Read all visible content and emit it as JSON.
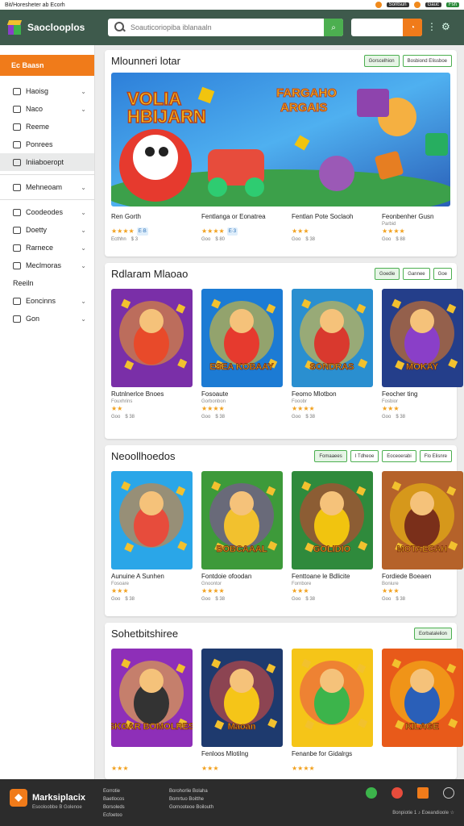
{
  "status_bar": {
    "left_text": "Bit/Horesheter ab Ecorh",
    "badges": [
      "Sontsun",
      "Gauc",
      "Fsh"
    ]
  },
  "header": {
    "brand": "Saoclooplos",
    "search_placeholder": "Soauticoriopiba iblanaaln",
    "search_button_icon": "search-icon"
  },
  "sidebar": {
    "active": "Ec Baasn",
    "items": [
      {
        "label": "Haoisg",
        "icon": "store-icon",
        "chevron": true
      },
      {
        "label": "Naco",
        "icon": "tag-icon",
        "chevron": true
      },
      {
        "label": "Reeme",
        "icon": "grid-icon",
        "chevron": false
      },
      {
        "label": "Ponrees",
        "icon": "doc-icon",
        "chevron": false
      },
      {
        "label": "Iniiaboeropt",
        "icon": "box-icon",
        "chevron": false,
        "highlight": true
      },
      {
        "label": "Mehneoam",
        "icon": "home-icon",
        "chevron": true
      },
      {
        "label": "Coodeodes",
        "icon": "folder-icon",
        "chevron": true
      },
      {
        "label": "Doetty",
        "icon": "card-icon",
        "chevron": true
      },
      {
        "label": "Rarnece",
        "icon": "clock-icon",
        "chevron": true
      },
      {
        "label": "Meclmoras",
        "icon": "circle-icon",
        "chevron": true
      },
      {
        "label": "Reeiln",
        "icon": "none",
        "chevron": false
      },
      {
        "label": "Eoncinns",
        "icon": "shield-icon",
        "chevron": true
      },
      {
        "label": "Gon",
        "icon": "globe-icon",
        "chevron": true
      }
    ]
  },
  "sections": [
    {
      "title": "Mlounneri lotar",
      "buttons": [
        "Gorscelhion",
        "Bosbiond Elissboe"
      ],
      "banner_text": [
        "VOLIA",
        "HBIJARN",
        "FARGAHO",
        "ARGAIS"
      ],
      "items": [
        {
          "title": "Ren Gorth",
          "sub": "",
          "stars": "★★★★",
          "price": "E·B",
          "meta": [
            "Ecthhn",
            "$ 3"
          ]
        },
        {
          "title": "Fentlanga or Eonatrea",
          "sub": "",
          "stars": "★★★★",
          "price": "E·3",
          "meta": [
            "Goo",
            "$ 80"
          ]
        },
        {
          "title": "Fentlan Pote Soclaoh",
          "sub": "",
          "stars": "★★★",
          "price": "",
          "meta": [
            "Goo",
            "$ 38"
          ]
        },
        {
          "title": "Feonbenher Gusn",
          "sub": "Parbid",
          "stars": "★★★★",
          "price": "",
          "meta": [
            "Goo",
            "$ 88"
          ]
        }
      ]
    },
    {
      "title": "Rdlaram Mlaoao",
      "buttons": [
        "Goedie",
        "Gannee",
        "Goe"
      ],
      "items": [
        {
          "title": "Rutnlnerlce Bnoes",
          "sub": "Fouxhrins",
          "stars": "★★",
          "meta": [
            "Goo",
            "$ 38"
          ]
        },
        {
          "title": "Fosoaute",
          "sub": "Gorbonbon",
          "stars": "★★★★",
          "meta": [
            "Goo",
            "$ 38"
          ]
        },
        {
          "title": "Feomo Mlotbon",
          "sub": "Fooobr",
          "stars": "★★★★",
          "meta": [
            "Goo",
            "$ 38"
          ]
        },
        {
          "title": "Feocher ting",
          "sub": "Fosbior",
          "stars": "★★★",
          "meta": [
            "Goo",
            "$ 38"
          ]
        }
      ],
      "thumb_text": [
        "",
        "ESEA KOBAAY",
        "SONDRAS",
        "MOKAY"
      ]
    },
    {
      "title": "Neoollhoedos",
      "buttons": [
        "Fomaaees",
        "I Tdheoe",
        "Eoceoerabi",
        "Flo Elisnre"
      ],
      "items": [
        {
          "title": "Aunuine A Sunhen",
          "sub": "Fosoare",
          "stars": "★★★",
          "meta": [
            "Goo",
            "$ 38"
          ]
        },
        {
          "title": "Fontdoie ofoodan",
          "sub": "Gnoontor",
          "stars": "★★★★",
          "meta": [
            "Goo",
            "$ 38"
          ]
        },
        {
          "title": "Fenttoane le Bdlicite",
          "sub": "Fornbore",
          "stars": "★★★",
          "meta": [
            "Goo",
            "$ 38"
          ]
        },
        {
          "title": "Fordiede Boeaen",
          "sub": "Boniure",
          "stars": "★★★",
          "meta": [
            "Goo",
            "$ 38"
          ]
        }
      ],
      "thumb_text": [
        "",
        "BOBCAAAL",
        "GOLIDIO",
        "MOTAECAH"
      ]
    },
    {
      "title": "Sohetbitshiree",
      "buttons": [
        "Eorbatalelion"
      ],
      "items": [
        {
          "title": "",
          "sub": "",
          "stars": "★★★",
          "meta": []
        },
        {
          "title": "Fenloos Mlotilng",
          "sub": "",
          "stars": "★★★",
          "meta": []
        },
        {
          "title": "Fenanbe for Gidalrgs",
          "sub": "",
          "stars": "★★★★",
          "meta": []
        },
        {
          "title": "",
          "sub": "",
          "stars": "",
          "meta": []
        }
      ],
      "thumb_text": [
        "SKGAR BOMOLRES",
        "Maoan",
        "",
        "KILAGE"
      ]
    }
  ],
  "footer": {
    "brand": "Marksiplacix",
    "tagline": "Esooloobbe B Golenoe",
    "col1": [
      "Eorrotie",
      "Baetlocos",
      "Borsoleds",
      "Ecfoetoo"
    ],
    "col2": [
      "Borohorlie Bolaha",
      "Bomrtuo Boitthe",
      "Gornooteoe Boilouth"
    ],
    "bottom": "Bonpiotie 1 ♪ Eoeandioole ☆"
  },
  "colors": {
    "header_bg": "#3e5a4c",
    "accent_orange": "#f07b1a",
    "accent_green": "#4caf50",
    "footer_bg": "#2c2c2c"
  }
}
